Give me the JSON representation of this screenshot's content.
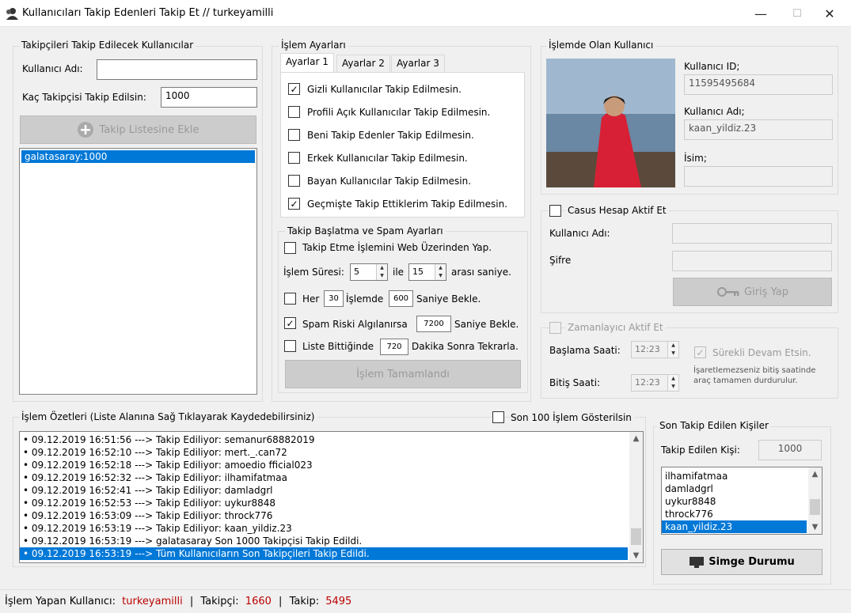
{
  "window": {
    "title": "Kullanıcıları Takip Edenleri Takip Et // turkeyamilli",
    "min": "—",
    "max": "☐",
    "close": "✕"
  },
  "left_group": {
    "legend": "Takipçileri Takip Edilecek Kullanıcılar",
    "username_label": "Kullanıcı Adı:",
    "username_value": "",
    "count_label": "Kaç Takipçisi Takip Edilsin:",
    "count_value": "1000",
    "add_button": "Takip Listesine Ekle",
    "list": [
      "galatasaray:1000"
    ]
  },
  "settings": {
    "legend": "İşlem Ayarları",
    "tabs": [
      "Ayarlar 1",
      "Ayarlar 2",
      "Ayarlar 3"
    ],
    "options": [
      {
        "label": "Gizli Kullanıcılar Takip Edilmesin.",
        "checked": true
      },
      {
        "label": "Profili Açık Kullanıcılar Takip Edilmesin.",
        "checked": false
      },
      {
        "label": "Beni Takip Edenler Takip Edilmesin.",
        "checked": false
      },
      {
        "label": "Erkek Kullanıcılar Takip Edilmesin.",
        "checked": false
      },
      {
        "label": "Bayan Kullanıcılar Takip Edilmesin.",
        "checked": false
      },
      {
        "label": "Geçmişte Takip Ettiklerim Takip Edilmesin.",
        "checked": true
      }
    ]
  },
  "spam": {
    "legend": "Takip Başlatma ve Spam Ayarları",
    "web_label": "Takip Etme İşlemini Web Üzerinden Yap.",
    "duration_label": "İşlem Süresi:",
    "duration_min": "5",
    "ile": "ile",
    "duration_max": "15",
    "arasi": "arası saniye.",
    "her_label": "Her",
    "her_value": "30",
    "islemde": "İşlemde",
    "wait_value": "600",
    "saniye_bekle": "Saniye Bekle.",
    "spam_label": "Spam Riski Algılanırsa",
    "spam_value": "7200",
    "spam_suffix": "Saniye Bekle.",
    "liste_label": "Liste Bittiğinde",
    "liste_value": "720",
    "liste_suffix": "Dakika Sonra Tekrarla.",
    "complete_button": "İşlem Tamamlandı"
  },
  "current_user": {
    "legend": "İşlemde Olan Kullanıcı",
    "id_label": "Kullanıcı ID;",
    "id_value": "11595495684",
    "name_label": "Kullanıcı Adı;",
    "name_value": "kaan_yildiz.23",
    "isim_label": "İsim;",
    "isim_value": ""
  },
  "spy": {
    "checkbox_label": "Casus Hesap Aktif Et",
    "user_label": "Kullanıcı Adı:",
    "pass_label": "Şifre",
    "login_button": "Giriş Yap"
  },
  "timer": {
    "checkbox_label": "Zamanlayıcı Aktif Et",
    "start_label": "Başlama Saati:",
    "start_value": "12:23",
    "end_label": "Bitiş Saati:",
    "end_value": "12:23",
    "continue_label": "Sürekli Devam Etsin.",
    "note": "İşaretlemezseniz bitiş saatinde araç tamamen durdurulur."
  },
  "log": {
    "legend": "İşlem Özetleri (Liste Alanına Sağ Tıklayarak Kaydedebilirsiniz)",
    "last100_label": "Son 100 İşlem Gösterilsin",
    "entries": [
      "•  09.12.2019 16:51:56 ---> Takip Ediliyor: semanur68882019",
      "•  09.12.2019 16:52:10 ---> Takip Ediliyor: mert._.can72",
      "•  09.12.2019 16:52:18 ---> Takip Ediliyor: amoedio fficial023",
      "•  09.12.2019 16:52:32 ---> Takip Ediliyor: ilhamifatmaa",
      "•  09.12.2019 16:52:41 ---> Takip Ediliyor: damladgrl",
      "•  09.12.2019 16:52:53 ---> Takip Ediliyor: uykur8848",
      "•  09.12.2019 16:53:09 ---> Takip Ediliyor: throck776",
      "•  09.12.2019 16:53:19 ---> Takip Ediliyor: kaan_yildiz.23",
      "•  09.12.2019 16:53:19 --->  galatasaray Son 1000 Takipçisi Takip Edildi.",
      "•  09.12.2019 16:53:19 ---> Tüm Kullanıcıların Son Takipçileri Takip Edildi."
    ]
  },
  "recent": {
    "legend": "Son Takip Edilen Kişiler",
    "count_label": "Takip Edilen Kişi:",
    "count_value": "1000",
    "list": [
      "ilhamifatmaa",
      "damladgrl",
      "uykur8848",
      "throck776",
      "kaan_yildiz.23"
    ],
    "tray_button": "Simge Durumu"
  },
  "status": {
    "user_label": "İşlem Yapan Kullanıcı:",
    "user_value": "turkeyamilli",
    "sep1": "|",
    "followers_label": "Takipçi:",
    "followers_value": "1660",
    "sep2": "|",
    "following_label": "Takip:",
    "following_value": "5495"
  }
}
